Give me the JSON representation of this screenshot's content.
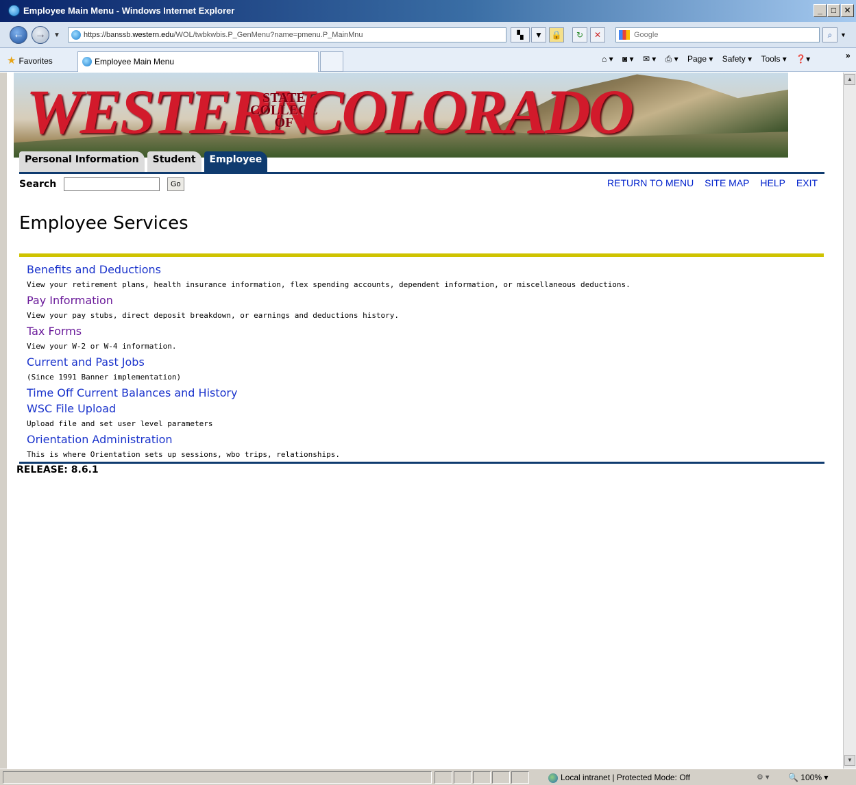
{
  "window": {
    "title": "Employee Main Menu - Windows Internet Explorer"
  },
  "browser": {
    "address_prefix": "https://banssb.",
    "address_domain": "western.edu",
    "address_path": "/WOL/twbkwbis.P_GenMenu?name=pmenu.P_MainMnu",
    "search_placeholder": "Google",
    "favorites_label": "Favorites",
    "tab_label": "Employee Main Menu",
    "commands": [
      "Page ▾",
      "Safety ▾",
      "Tools ▾"
    ]
  },
  "banner": {
    "word1": "WESTERN",
    "word2_line1": "STATE",
    "word2_line2": "COLLEGE",
    "word2_line3": "OF",
    "word3": "COLORADO"
  },
  "tabs": [
    {
      "label": "Personal Information",
      "active": false
    },
    {
      "label": "Student",
      "active": false
    },
    {
      "label": "Employee",
      "active": true
    }
  ],
  "search": {
    "label": "Search",
    "value": "",
    "go_label": "Go"
  },
  "top_links": [
    "RETURN TO MENU",
    "SITE MAP",
    "HELP",
    "EXIT"
  ],
  "page": {
    "title": "Employee Services",
    "release": "RELEASE: 8.6.1"
  },
  "menu": [
    {
      "label": "Benefits and Deductions",
      "desc": "View your retirement plans, health insurance information, flex spending accounts, dependent information, or miscellaneous deductions."
    },
    {
      "label": "Pay Information",
      "desc": "View your pay stubs, direct deposit breakdown, or earnings and deductions history."
    },
    {
      "label": "Tax Forms",
      "desc": "View your W-2 or W-4 information."
    },
    {
      "label": "Current and Past Jobs",
      "desc": "(Since 1991 Banner implementation)"
    },
    {
      "label": "Time Off Current Balances and History",
      "desc": ""
    },
    {
      "label": "WSC File Upload",
      "desc": "Upload file and set user level parameters"
    },
    {
      "label": "Orientation Administration",
      "desc": "This is where Orientation sets up sessions, wbo trips, relationships."
    }
  ],
  "status": {
    "zone": "Local intranet | Protected Mode: Off",
    "zoom": "100%"
  },
  "colors": {
    "tab_active": "#0f3b6f",
    "rule_gold": "#cfc300",
    "link": "#1a33cc",
    "link_visited": "#6a1a9a"
  }
}
